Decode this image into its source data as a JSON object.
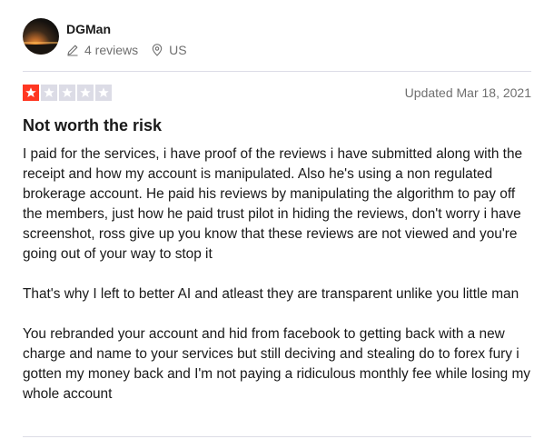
{
  "reviewer": {
    "name": "DGMan",
    "reviews_count": "4 reviews",
    "country": "US"
  },
  "review": {
    "rating": 1,
    "max_rating": 5,
    "date": "Updated Mar 18, 2021",
    "title": "Not worth the risk",
    "paragraphs": [
      "I paid for the services, i have proof of the reviews i have submitted along with the receipt and how my account is manipulated. Also he's using a non regulated brokerage account. He paid his reviews by manipulating the algorithm to pay off the members, just how he paid trust pilot in hiding the reviews, don't worry i have screenshot, ross give up you know that these reviews are not viewed and you're going out of your way to stop it",
      "That's why I left to better AI and atleast they are transparent unlike you little man",
      "You rebranded your account and hid from facebook to getting back with a new charge and name to your services but still deciving and stealing do to forex fury i gotten my money back and I'm not paying a ridiculous monthly fee while losing my whole account"
    ]
  },
  "colors": {
    "star_filled": "#ff3722",
    "star_empty": "#dcdce6",
    "muted_text": "#6f6f6f"
  },
  "icons": {
    "reviews": "pencil-icon",
    "country": "location-pin-icon",
    "star": "star-icon"
  }
}
